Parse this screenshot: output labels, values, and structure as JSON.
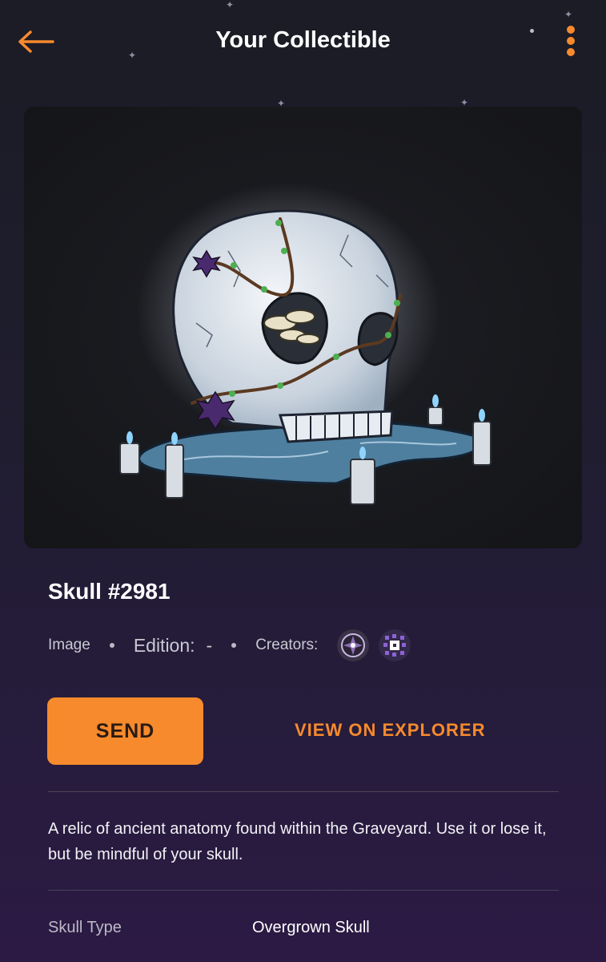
{
  "header": {
    "title": "Your Collectible",
    "back_icon": "arrow-left-icon",
    "menu_icon": "kebab-menu-icon",
    "accent": "#f78a2d"
  },
  "collectible": {
    "name": "Skull #2981",
    "media_type": "Image",
    "edition_label": "Edition:",
    "edition_value": "-",
    "creators_label": "Creators:",
    "description": "A relic of ancient anatomy found within the Graveyard. Use it or lose it, but be mindful of your skull."
  },
  "actions": {
    "send_label": "SEND",
    "explorer_label": "VIEW ON EXPLORER"
  },
  "attributes": [
    {
      "key": "Skull Type",
      "value": "Overgrown Skull"
    }
  ]
}
